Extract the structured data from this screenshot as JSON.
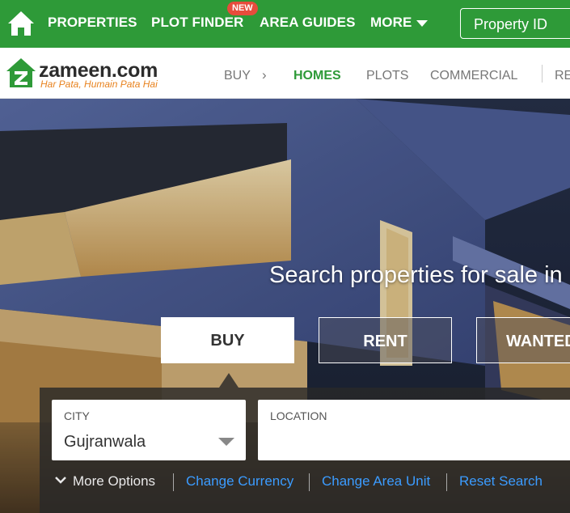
{
  "topnav": {
    "properties": "PROPERTIES",
    "plot_finder": "PLOT FINDER",
    "new_badge": "NEW",
    "area_guides": "AREA GUIDES",
    "more": "MORE",
    "property_id": "Property ID"
  },
  "brand": {
    "name": "zameen.com",
    "tagline": "Har Pata, Humain Pata Hai"
  },
  "subnav": {
    "buy": "BUY",
    "arrow": "›",
    "homes": "HOMES",
    "plots": "PLOTS",
    "commercial": "COMMERCIAL",
    "partial": "RE"
  },
  "hero": {
    "heading": "Search properties for sale in",
    "tabs": {
      "buy": "BUY",
      "rent": "RENT",
      "wanted": "WANTED"
    }
  },
  "search": {
    "city_label": "CITY",
    "city_value": "Gujranwala",
    "location_label": "LOCATION",
    "more_options": "More Options",
    "change_currency": "Change Currency",
    "change_area_unit": "Change Area Unit",
    "reset_search": "Reset Search"
  },
  "colors": {
    "brand_green": "#2e9a38",
    "accent_orange": "#e8821e",
    "badge_red": "#e74c3c",
    "link_blue": "#3b9cff"
  },
  "icons": [
    "home-icon",
    "chevron-down-icon",
    "zameen-logo-icon"
  ]
}
